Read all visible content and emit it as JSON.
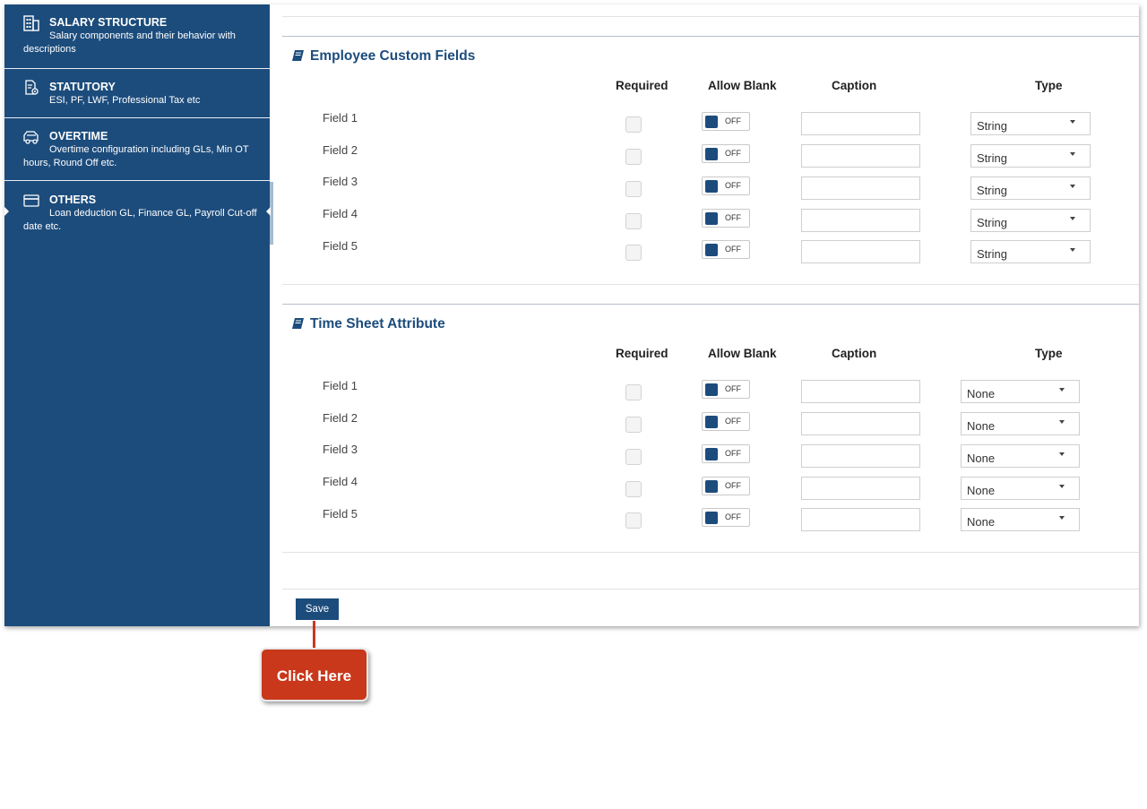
{
  "sidebar": {
    "items": [
      {
        "title": "SALARY STRUCTURE",
        "desc": "Salary components and their behavior with descriptions",
        "icon": "building-icon"
      },
      {
        "title": "STATUTORY",
        "desc": "ESI, PF, LWF, Professional Tax etc",
        "icon": "document-settings-icon"
      },
      {
        "title": "OVERTIME",
        "desc": "Overtime configuration including GLs, Min OT hours, Round Off etc.",
        "icon": "vehicle-icon"
      },
      {
        "title": "OTHERS",
        "desc": "Loan deduction GL, Finance GL, Payroll Cut-off date etc.",
        "icon": "card-icon"
      }
    ],
    "active": "OTHERS"
  },
  "columns": {
    "required": "Required",
    "allow_blank": "Allow Blank",
    "caption": "Caption",
    "type": "Type"
  },
  "employee_section": {
    "title": "Employee Custom Fields",
    "fields": [
      {
        "label": "Field 1",
        "required": false,
        "allow_blank": "OFF",
        "caption": "",
        "type": "String"
      },
      {
        "label": "Field 2",
        "required": false,
        "allow_blank": "OFF",
        "caption": "",
        "type": "String"
      },
      {
        "label": "Field 3",
        "required": false,
        "allow_blank": "OFF",
        "caption": "",
        "type": "String"
      },
      {
        "label": "Field 4",
        "required": false,
        "allow_blank": "OFF",
        "caption": "",
        "type": "String"
      },
      {
        "label": "Field 5",
        "required": false,
        "allow_blank": "OFF",
        "caption": "",
        "type": "String"
      }
    ]
  },
  "timesheet_section": {
    "title": "Time Sheet Attribute",
    "fields": [
      {
        "label": "Field 1",
        "required": false,
        "allow_blank": "OFF",
        "caption": "",
        "type": "None"
      },
      {
        "label": "Field 2",
        "required": false,
        "allow_blank": "OFF",
        "caption": "",
        "type": "None"
      },
      {
        "label": "Field 3",
        "required": false,
        "allow_blank": "OFF",
        "caption": "",
        "type": "None"
      },
      {
        "label": "Field 4",
        "required": false,
        "allow_blank": "OFF",
        "caption": "",
        "type": "None"
      },
      {
        "label": "Field 5",
        "required": false,
        "allow_blank": "OFF",
        "caption": "",
        "type": "None"
      }
    ]
  },
  "save_label": "Save",
  "callout_label": "Click Here",
  "colors": {
    "brand": "#1c4c7c",
    "callout": "#c9381a"
  }
}
